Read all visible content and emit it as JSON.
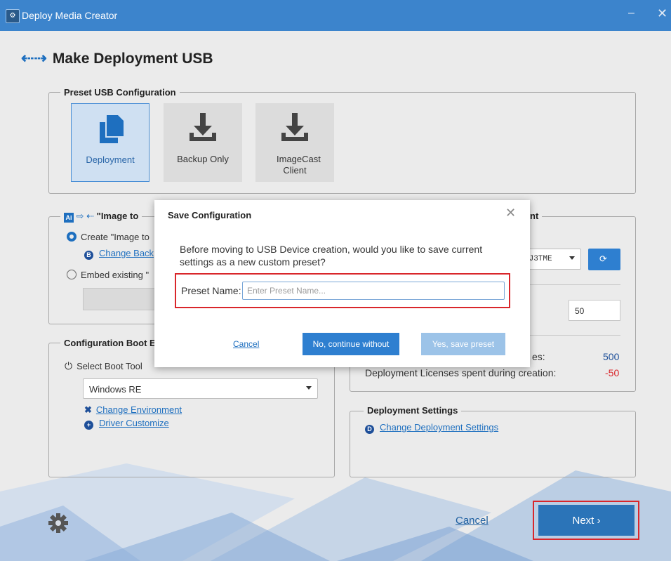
{
  "window": {
    "title": "Deploy Media Creator",
    "minimize_label": "–",
    "close_label": "✕"
  },
  "page": {
    "heading": "Make Deployment USB"
  },
  "preset_group": {
    "legend": "Preset USB Configuration",
    "items": [
      {
        "label": "Deployment",
        "selected": true,
        "icon": "copy-icon"
      },
      {
        "label": "Backup Only",
        "selected": false,
        "icon": "download-icon"
      },
      {
        "label": "ImageCast Client",
        "selected": false,
        "icon": "download-icon"
      }
    ]
  },
  "image_group": {
    "legend": "\"Image to",
    "create_option": "Create \"Image to",
    "change_backup_link": "Change Back",
    "embed_option": "Embed existing \""
  },
  "boot_group": {
    "legend": "Configuration Boot E",
    "select_label": "Select Boot Tool",
    "selected_tool": "Windows RE",
    "change_env_link": "Change Environment",
    "driver_link": "Driver Customize"
  },
  "right_group": {
    "legend_fragment": "nt",
    "device_value": "UJ3TME",
    "count_value": "50",
    "licenses_available_fragment": "es:",
    "licenses_available_value": "500",
    "licenses_spent_label": "Deployment Licenses spent during creation:",
    "licenses_spent_value": "-50"
  },
  "deployment_settings": {
    "legend": "Deployment Settings",
    "link": "Change Deployment Settings"
  },
  "dialog": {
    "title": "Save Configuration",
    "message": "Before moving to USB Device creation, would you like to save current settings as a new custom preset?",
    "preset_name_label": "Preset Name:",
    "preset_name_placeholder": "Enter Preset Name...",
    "cancel_label": "Cancel",
    "no_label": "No, continue without",
    "yes_label": "Yes, save preset",
    "close_label": "✕"
  },
  "footer": {
    "cancel_label": "Cancel",
    "next_label": "Next ›"
  },
  "colors": {
    "accent": "#2e7fd0",
    "titlebar": "#3c84cc",
    "highlight_border": "#d9262b",
    "negative": "#d9262b",
    "licenses_value": "#1e4f99"
  }
}
